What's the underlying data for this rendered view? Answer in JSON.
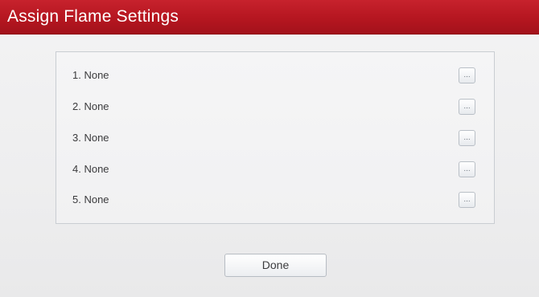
{
  "dialog": {
    "title": "Assign Flame Settings"
  },
  "slots": [
    {
      "label": "1. None",
      "button_label": "..."
    },
    {
      "label": "2. None",
      "button_label": "..."
    },
    {
      "label": "3. None",
      "button_label": "..."
    },
    {
      "label": "4. None",
      "button_label": "..."
    },
    {
      "label": "5. None",
      "button_label": "..."
    }
  ],
  "footer": {
    "done_label": "Done"
  },
  "colors": {
    "titlebar": "#b51620",
    "title_text": "#ffffff",
    "background": "#eeeeef"
  }
}
